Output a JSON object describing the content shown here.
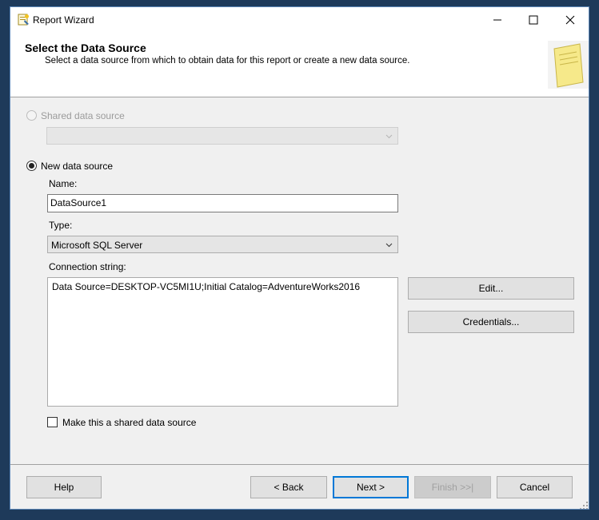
{
  "window": {
    "title": "Report Wizard"
  },
  "header": {
    "title": "Select the Data Source",
    "subtitle": "Select a data source from which to obtain data for this report or create a new data source."
  },
  "shared_source": {
    "label": "Shared data source",
    "selected": false,
    "enabled": false,
    "value": ""
  },
  "new_source": {
    "label": "New data source",
    "selected": true,
    "name_label": "Name:",
    "name_value": "DataSource1",
    "type_label": "Type:",
    "type_value": "Microsoft SQL Server",
    "connection_label": "Connection string:",
    "connection_value": "Data Source=DESKTOP-VC5MI1U;Initial Catalog=AdventureWorks2016",
    "edit_label": "Edit...",
    "credentials_label": "Credentials..."
  },
  "make_shared": {
    "label": "Make this a shared data source",
    "checked": false
  },
  "footer": {
    "help_label": "Help",
    "back_label": "< Back",
    "next_label": "Next >",
    "finish_label": "Finish >>|",
    "cancel_label": "Cancel"
  },
  "icons": {
    "app": "report-wizard-icon",
    "minimize": "minimize-icon",
    "maximize": "maximize-icon",
    "close": "close-icon",
    "header": "document-icon",
    "dropdown": "chevron-down-icon"
  },
  "colors": {
    "accent": "#0078d7",
    "window_border": "#5c87b8",
    "desktop": "#1e3a5a"
  }
}
